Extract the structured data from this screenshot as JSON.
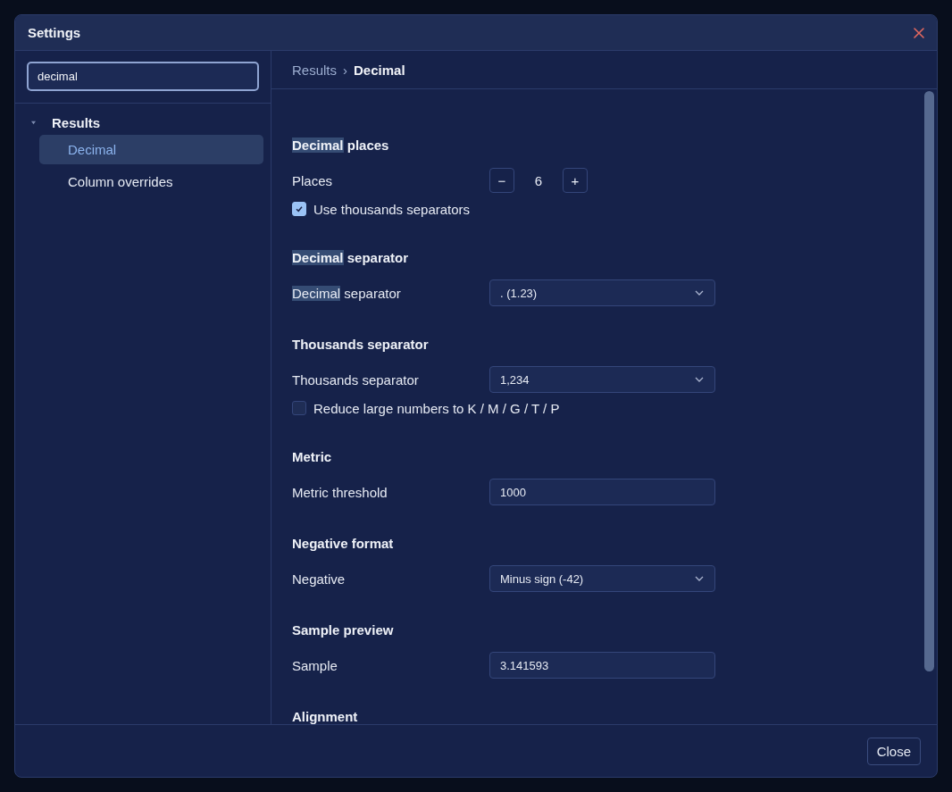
{
  "window": {
    "title": "Settings"
  },
  "search": {
    "value": "decimal"
  },
  "tree": [
    {
      "label": "Results",
      "expanded": true,
      "children": [
        {
          "label": "Decimal",
          "selected": true
        },
        {
          "label": "Column overrides",
          "selected": false
        }
      ]
    }
  ],
  "breadcrumb": {
    "parent": "Results",
    "separator": "›",
    "current": "Decimal"
  },
  "sections": [
    {
      "title": [
        {
          "text": "Decimal",
          "highlighted": true
        },
        {
          "text": " places",
          "highlighted": false
        }
      ],
      "rows": [
        {
          "kind": "stepper",
          "label": [
            {
              "text": "Places",
              "highlighted": false
            }
          ],
          "minus": "−",
          "value": "6",
          "plus": "+"
        },
        {
          "kind": "checkbox",
          "label": [
            {
              "text": "Use thousands separators",
              "highlighted": false
            }
          ],
          "checked": true
        }
      ]
    },
    {
      "title": [
        {
          "text": "Decimal",
          "highlighted": true
        },
        {
          "text": " separator",
          "highlighted": false
        }
      ],
      "rows": [
        {
          "kind": "select",
          "label": [
            {
              "text": "Decimal",
              "highlighted": true
            },
            {
              "text": " separator",
              "highlighted": false
            }
          ],
          "value": ". (1.23)"
        }
      ]
    },
    {
      "title": [
        {
          "text": "Thousands separator",
          "highlighted": false
        }
      ],
      "rows": [
        {
          "kind": "select",
          "label": [
            {
              "text": "Thousands separator",
              "highlighted": false
            }
          ],
          "value": "1,234"
        },
        {
          "kind": "checkbox",
          "label": [
            {
              "text": "Reduce large numbers to K / M / G / T / P",
              "highlighted": false
            }
          ],
          "checked": false
        }
      ]
    },
    {
      "title": [
        {
          "text": "Metric",
          "highlighted": false
        }
      ],
      "rows": [
        {
          "kind": "input",
          "label": [
            {
              "text": "Metric threshold",
              "highlighted": false
            }
          ],
          "value": "1000"
        }
      ]
    },
    {
      "title": [
        {
          "text": "Negative format",
          "highlighted": false
        }
      ],
      "rows": [
        {
          "kind": "select",
          "label": [
            {
              "text": "Negative",
              "highlighted": false
            }
          ],
          "value": "Minus sign (-42)"
        }
      ]
    },
    {
      "title": [
        {
          "text": "Sample preview",
          "highlighted": false
        }
      ],
      "rows": [
        {
          "kind": "input",
          "label": [
            {
              "text": "Sample",
              "highlighted": false
            }
          ],
          "value": "3.141593"
        }
      ]
    },
    {
      "title": [
        {
          "text": "Alignment",
          "highlighted": false
        }
      ]
    }
  ],
  "footer": {
    "close_button": "Close"
  }
}
